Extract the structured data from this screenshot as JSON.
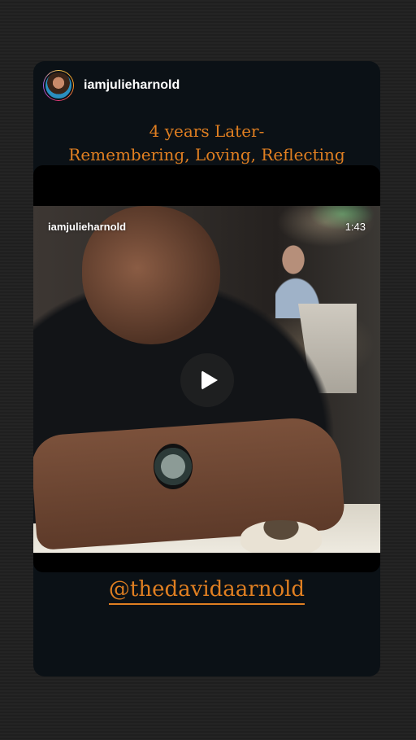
{
  "story": {
    "username": "iamjulieharnold",
    "caption_line1": "4 years Later-",
    "caption_line2": "Remembering, Loving, Reflecting",
    "mention": "@thedavidaarnold"
  },
  "video": {
    "username": "iamjulieharnold",
    "duration": "1:43",
    "play_icon": "play-icon"
  },
  "colors": {
    "accent": "#e07f21",
    "card_bg": "#0b1116",
    "page_bg": "#222222"
  }
}
